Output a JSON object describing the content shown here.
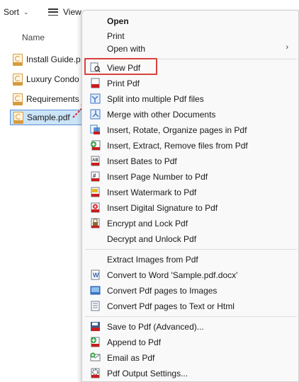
{
  "explorer": {
    "sort_label": "Sort",
    "view_label": "View",
    "column_name": "Name",
    "files": [
      {
        "name": "Install Guide.p",
        "selected": false
      },
      {
        "name": "Luxury Condo",
        "selected": false
      },
      {
        "name": "Requirements",
        "selected": false
      },
      {
        "name": "Sample.pdf",
        "selected": true
      }
    ]
  },
  "menu": {
    "open": "Open",
    "print": "Print",
    "open_with": "Open with",
    "view_pdf": "View Pdf",
    "print_pdf": "Print Pdf",
    "split": "Split into multiple Pdf files",
    "merge": "Merge with other Documents",
    "insert_rotate": "Insert, Rotate, Organize pages in Pdf",
    "insert_extract": "Insert, Extract, Remove files from Pdf",
    "insert_bates": "Insert Bates to Pdf",
    "insert_page_number": "Insert Page Number to Pdf",
    "insert_watermark": "Insert Watermark to Pdf",
    "insert_signature": "Insert Digital Signature to Pdf",
    "encrypt": "Encrypt and Lock Pdf",
    "decrypt": "Decrypt and Unlock Pdf",
    "extract_images": "Extract Images from Pdf",
    "convert_word": "Convert to Word 'Sample.pdf.docx'",
    "convert_images": "Convert Pdf pages to Images",
    "convert_text": "Convert Pdf pages to Text or Html",
    "save_advanced": "Save to Pdf (Advanced)...",
    "append": "Append to Pdf",
    "email": "Email as Pdf",
    "output_settings": "Pdf Output Settings..."
  },
  "colors": {
    "highlight_border": "#d9413c",
    "selection_bg": "#cce4f7",
    "menu_bg": "#f9f9f9"
  }
}
